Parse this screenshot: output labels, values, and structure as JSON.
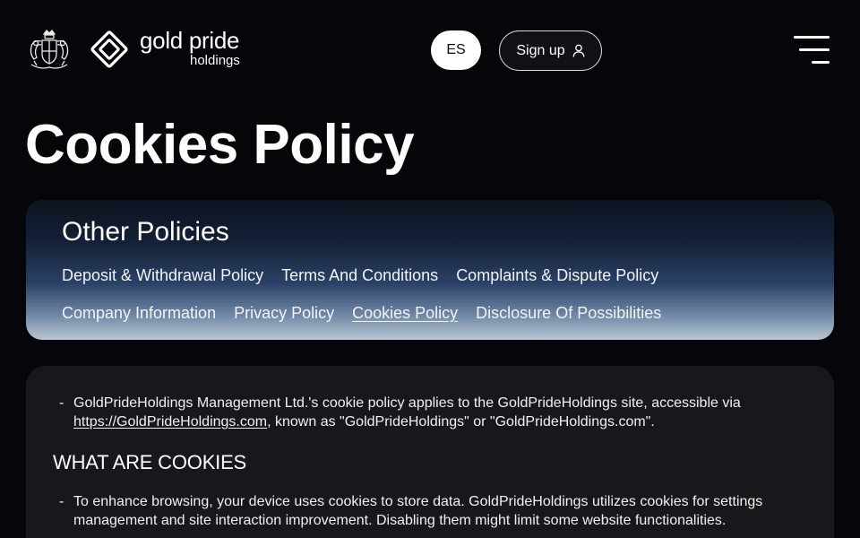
{
  "header": {
    "brand_name": "gold pride",
    "brand_sub": "holdings",
    "language_label": "ES",
    "signup_label": "Sign up",
    "icons": {
      "crest": "royal-crest-icon",
      "brand": "diamond-logo-icon",
      "user": "user-icon",
      "menu": "hamburger-menu-icon"
    }
  },
  "page": {
    "title": "Cookies Policy"
  },
  "policies": {
    "title": "Other Policies",
    "row1": [
      "Deposit & Withdrawal Policy",
      "Terms And Conditions",
      "Complaints & Dispute Policy"
    ],
    "row2": [
      "Company Information",
      "Privacy Policy",
      "Cookies Policy",
      "Disclosure Of Possibilities"
    ],
    "active": "Cookies Policy"
  },
  "content": {
    "intro_before": "GoldPrideHoldings Management Ltd.'s cookie policy applies to the GoldPrideHoldings site, accessible via ",
    "intro_url": "https://GoldPrideHoldings.com",
    "intro_after": ", known as \"GoldPrideHoldings\" or \"GoldPrideHoldings.com\".",
    "section_heading": "WHAT ARE COOKIES",
    "section_text": "To enhance browsing, your device uses cookies to store data. GoldPrideHoldings utilizes cookies for settings management and site interaction improvement. Disabling them might limit some website functionalities.",
    "dash": "-"
  },
  "colors": {
    "background": "#050609",
    "card_dark": "#17181b",
    "gradient_light": "#b9c7d3",
    "gradient_dark": "#142036"
  }
}
